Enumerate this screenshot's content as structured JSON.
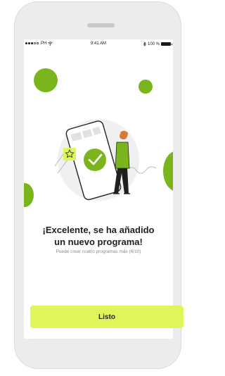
{
  "status_bar": {
    "carrier": "PH",
    "time": "9:41 AM",
    "battery": "100 %"
  },
  "icons": {
    "signal": "signal-dots-icon",
    "wifi": "wifi-icon",
    "bluetooth": "bluetooth-icon",
    "battery": "battery-icon",
    "star": "star-icon",
    "check": "check-icon"
  },
  "colors": {
    "accent_green": "#7ab51d",
    "button_bg": "#dff55a"
  },
  "content": {
    "headline_line1": "¡Excelente, se ha añadido",
    "headline_line2": "un nuevo programa!",
    "subtext": "Puede crear cuatro programas más (6/10)"
  },
  "actions": {
    "done_label": "Listo"
  }
}
